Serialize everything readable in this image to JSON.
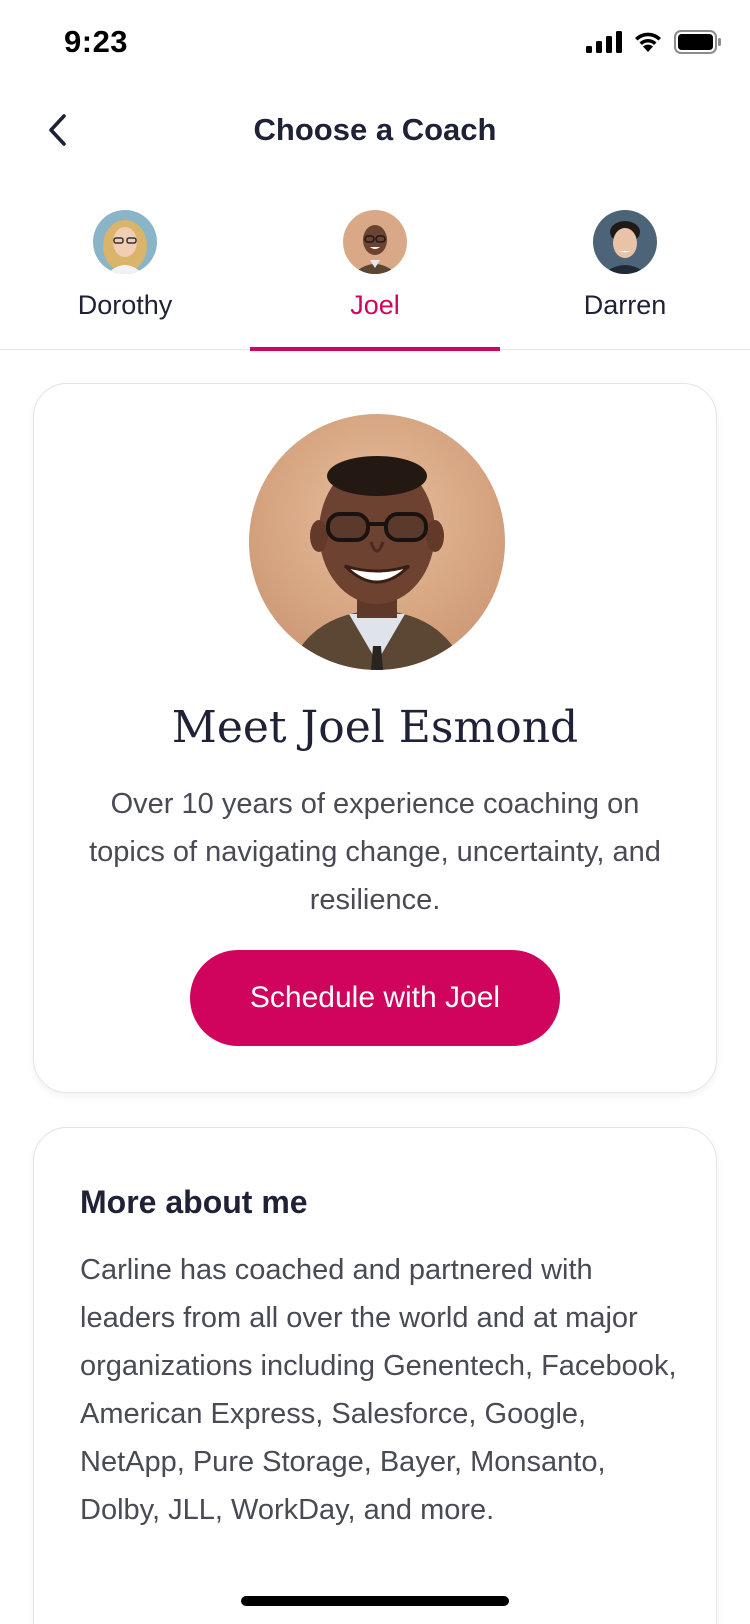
{
  "status_bar": {
    "time": "9:23"
  },
  "nav": {
    "title": "Choose a Coach",
    "back_icon": "chevron-left-icon"
  },
  "tabs": [
    {
      "label": "Dorothy",
      "active": false
    },
    {
      "label": "Joel",
      "active": true
    },
    {
      "label": "Darren",
      "active": false
    }
  ],
  "coach": {
    "name_heading": "Meet Joel Esmond",
    "summary": "Over 10 years of experience coaching on topics of navigating change, uncertainty, and resilience.",
    "schedule_label": "Schedule with Joel"
  },
  "about": {
    "heading": "More about me",
    "body": "Carline has coached and partnered with leaders from all over the world and at major organizations including Genentech, Facebook, American Express, Salesforce, Google, NetApp, Pure Storage, Bayer, Monsanto, Dolby, JLL, WorkDay, and more."
  },
  "colors": {
    "accent": "#d0045c",
    "text_dark": "#1f2237",
    "text_body": "#4a4a55"
  }
}
